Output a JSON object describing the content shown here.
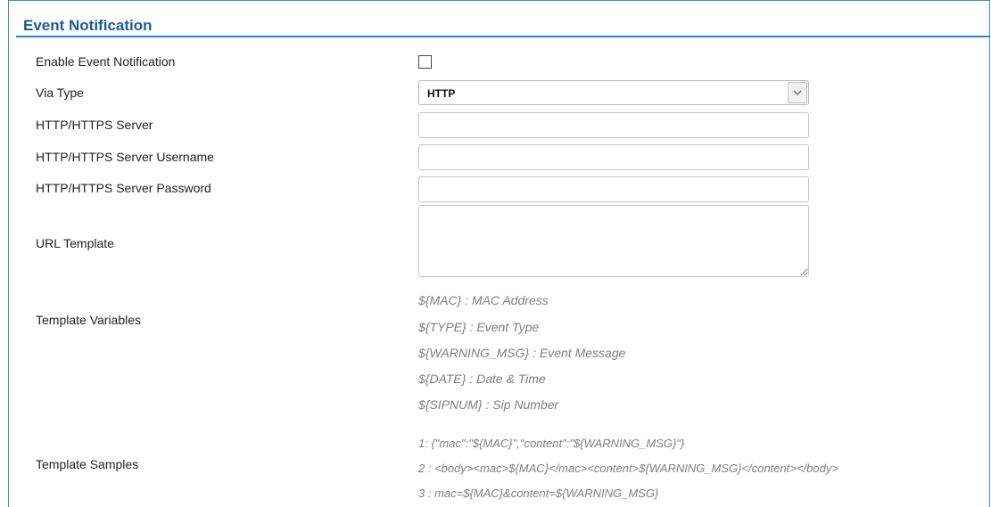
{
  "section": {
    "title": "Event Notification"
  },
  "fields": {
    "enable_label": "Enable Event Notification",
    "enable_checked": false,
    "via_type_label": "Via Type",
    "via_type_value": "HTTP",
    "server_label": "HTTP/HTTPS Server",
    "server_value": "",
    "username_label": "HTTP/HTTPS Server Username",
    "username_value": "",
    "password_label": "HTTP/HTTPS Server Password",
    "password_value": "",
    "url_template_label": "URL Template",
    "url_template_value": ""
  },
  "template_variables": {
    "label": "Template Variables",
    "items": [
      "${MAC} : MAC Address",
      "${TYPE} : Event Type",
      "${WARNING_MSG} : Event Message",
      "${DATE} : Date & Time",
      "${SIPNUM} : Sip Number"
    ]
  },
  "template_samples": {
    "label": "Template Samples",
    "items": [
      "1: {\"mac\":\"${MAC}\",\"content\":\"${WARNING_MSG}\"}",
      "2 : <body><mac>${MAC}</mac><content>${WARNING_MSG}</content></body>",
      "3 : mac=${MAC}&content=${WARNING_MSG}"
    ]
  },
  "colors": {
    "accent": "#2b86d1",
    "title": "#1a5a9c",
    "hint": "#808080"
  },
  "icons": {
    "select_arrow": "chevron-down-icon"
  }
}
